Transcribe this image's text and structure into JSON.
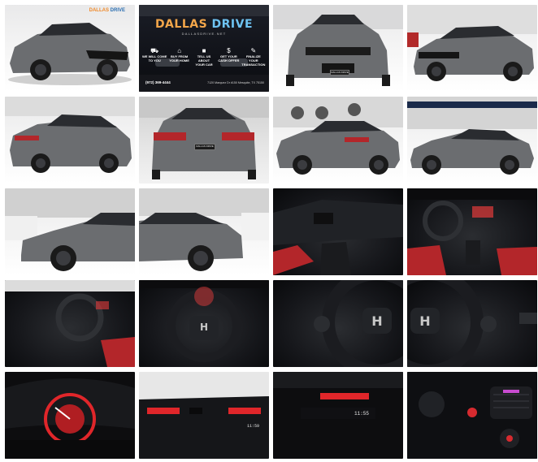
{
  "gallery": {
    "logo": {
      "brand_left": "DALLAS",
      "brand_right": "DRIVE",
      "tagline": "DALLASDRIVE.NET",
      "badges": [
        {
          "line1": "WE WILL COME",
          "line2": "TO YOU",
          "icon": "truck-icon"
        },
        {
          "line1": "BUY FROM",
          "line2": "YOUR HOME",
          "icon": "home-icon"
        },
        {
          "line1": "TELL US ABOUT",
          "line2": "YOUR CAR",
          "icon": "car-icon"
        },
        {
          "line1": "GET YOUR",
          "line2": "CASH OFFER",
          "icon": "cash-icon"
        },
        {
          "line1": "FINALIZE YOUR",
          "line2": "TRANSACTION",
          "icon": "document-icon"
        }
      ],
      "phone": "(972) 369-4444",
      "address": "7120 Marquez Dr #150 Mesquite, TX 75150"
    },
    "watermark_left": "DALLAS",
    "watermark_right": "DRIVE",
    "plate_text": "DALLAS DRIVE",
    "dash_time": "11:55",
    "dash_time_small": "11:59",
    "colors": {
      "car_body": "#6b6d70",
      "interior_red": "#b3262a",
      "brand_orange": "#f3a64a",
      "brand_blue": "#6ec3f2"
    }
  }
}
